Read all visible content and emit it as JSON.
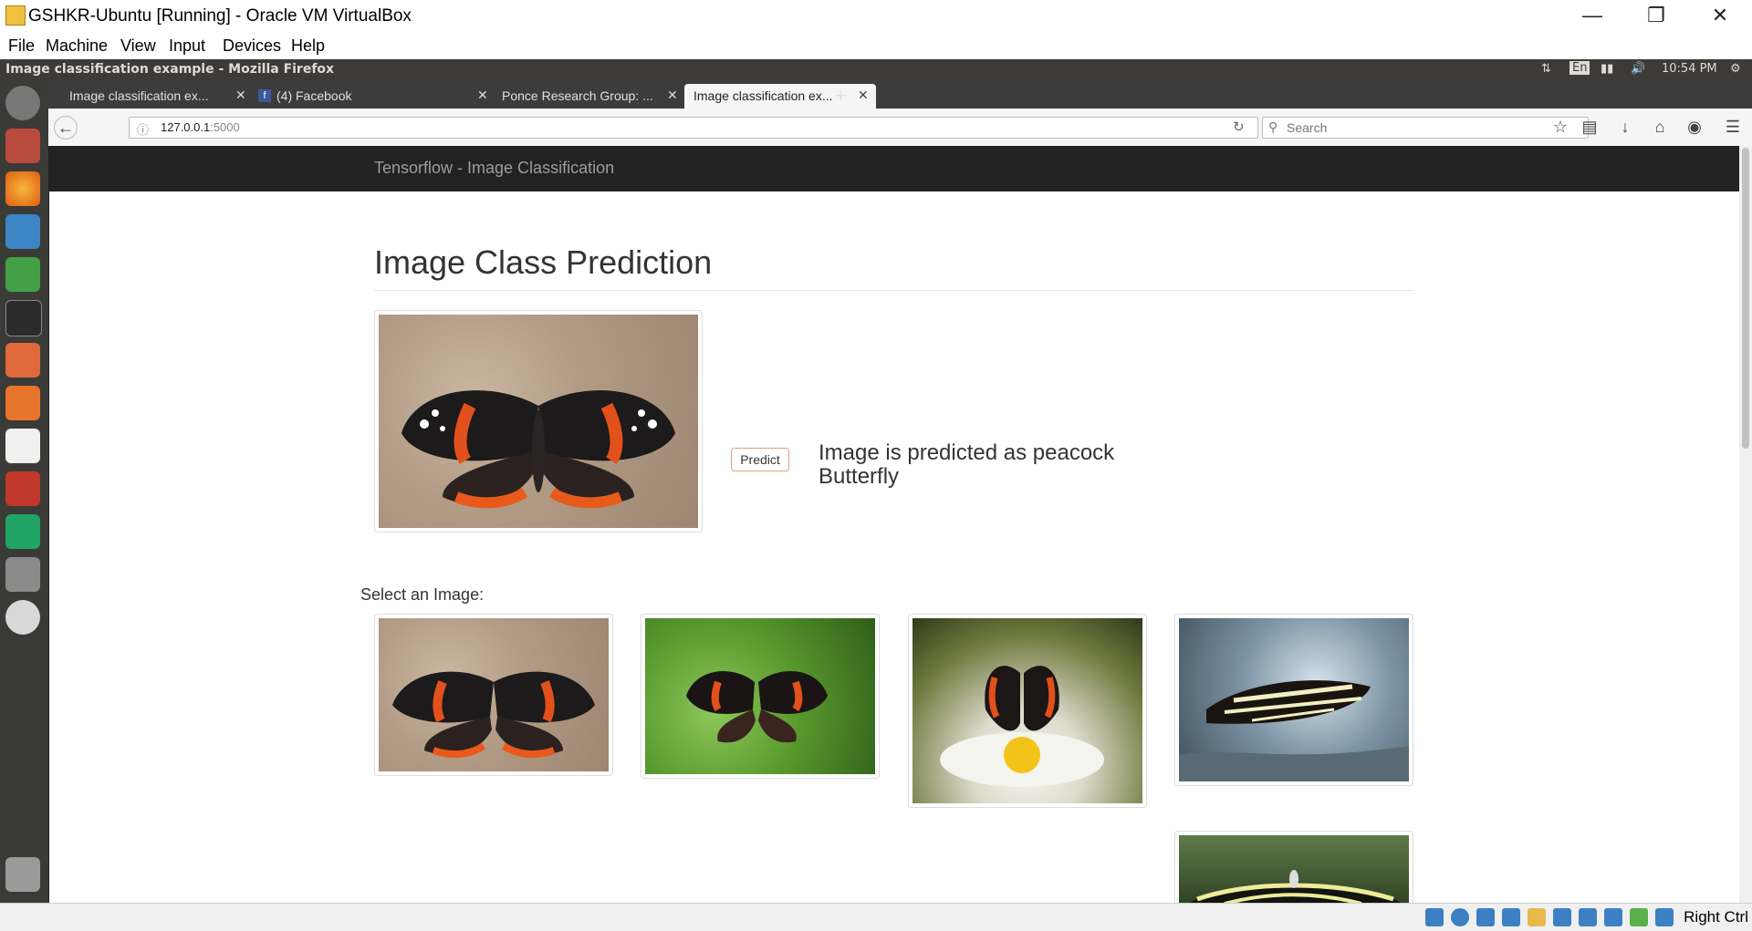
{
  "virtualbox": {
    "title": "GSHKR-Ubuntu [Running] - Oracle VM VirtualBox",
    "menu": [
      "File",
      "Machine",
      "View",
      "Input",
      "Devices",
      "Help"
    ],
    "host_key": "Right Ctrl"
  },
  "ubuntu_panel": {
    "window_title": "Image classification example - Mozilla Firefox",
    "keyboard": "En",
    "time": "10:54 PM"
  },
  "firefox": {
    "tabs": [
      {
        "label": "Image classification ex..."
      },
      {
        "label": "(4) Facebook"
      },
      {
        "label": "Ponce Research Group: ..."
      },
      {
        "label": "Image classification ex..."
      }
    ],
    "url_host": "127.0.0.1",
    "url_port": ":5000",
    "search_placeholder": "Search"
  },
  "page": {
    "brand": "Tensorflow - Image Classification",
    "heading": "Image Class Prediction",
    "predict_label": "Predict",
    "result_text": "Image is predicted as peacock Butterfly",
    "select_label": "Select an Image:"
  },
  "icons": {
    "launcher": [
      "dash-icon",
      "files-icon",
      "firefox-icon",
      "writer-icon",
      "calc-icon",
      "terminal-icon",
      "impress-icon",
      "software-center-icon",
      "amazon-icon",
      "settings-icon",
      "pycharm-icon",
      "drive-icon",
      "dvd-icon",
      "trash-icon"
    ]
  },
  "colors": {
    "page_navbar": "#222222",
    "launcher_bg": "#3a3a36",
    "panel_bg": "#3c3b37"
  }
}
